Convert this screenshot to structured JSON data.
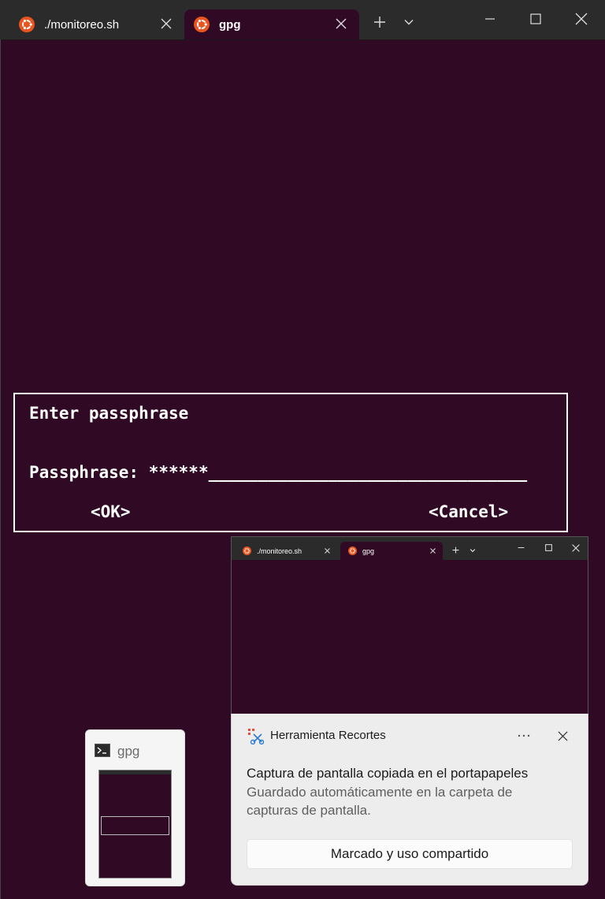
{
  "tabs": [
    {
      "label": "./monitoreo.sh",
      "active": false
    },
    {
      "label": "gpg",
      "active": true
    }
  ],
  "titlebar": {
    "new_tab_icon": "plus-icon",
    "dropdown_icon": "chevron-down-icon",
    "minimize_icon": "minimize-icon",
    "maximize_icon": "maximize-icon",
    "close_icon": "close-icon"
  },
  "dialog": {
    "title": "Enter passphrase",
    "passphrase_label": "Passphrase:",
    "passphrase_value": "******________________________________",
    "ok_button": "<OK>",
    "cancel_button": "<Cancel>"
  },
  "preview": {
    "tabs": [
      {
        "label": "./monitoreo.sh"
      },
      {
        "label": "gpg"
      }
    ]
  },
  "toast": {
    "app_name": "Herramienta Recortes",
    "more_icon": "more-dots-icon",
    "title": "Captura de pantalla copiada en el portapapeles",
    "body": "Guardado automáticamente en la carpeta de capturas de pantalla.",
    "action": "Marcado y uso compartido"
  },
  "taskbar_thumb": {
    "title": "gpg"
  },
  "colors": {
    "terminal_bg": "#300a24",
    "titlebar_bg": "#2b2b2b",
    "ubuntu_orange": "#e95420"
  }
}
